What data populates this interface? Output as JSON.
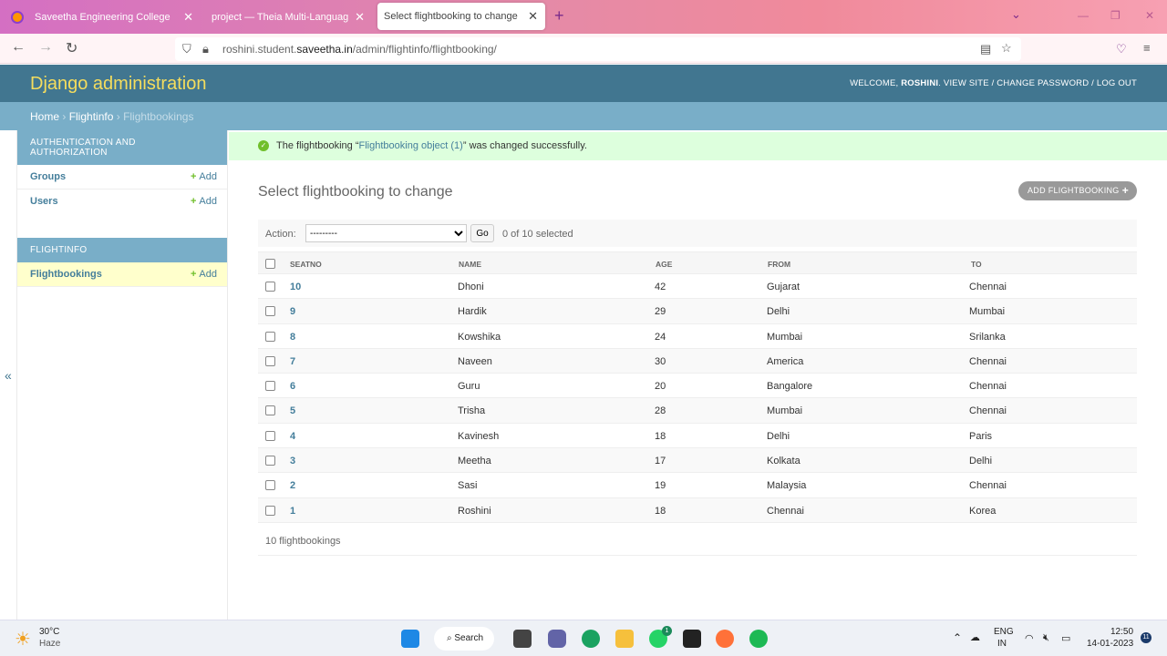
{
  "browser": {
    "tabs": [
      {
        "title": "Saveetha Engineering College"
      },
      {
        "title": "project — Theia Multi-Language Ex"
      },
      {
        "title": "Select flightbooking to change | Dj"
      }
    ],
    "url_prefix": "roshini.student.",
    "url_domain": "saveetha.in",
    "url_path": "/admin/flightinfo/flightbooking/"
  },
  "header": {
    "brand": "Django administration",
    "welcome": "WELCOME,",
    "user": "ROSHINI",
    "view_site": "VIEW SITE",
    "change_password": "CHANGE PASSWORD",
    "logout": "LOG OUT"
  },
  "breadcrumbs": {
    "home": "Home",
    "app": "Flightinfo",
    "current": "Flightbookings"
  },
  "sidebar": {
    "auth_title": "Authentication and Authorization",
    "groups": "Groups",
    "users": "Users",
    "add": "Add",
    "app_title": "Flightinfo",
    "flightbookings": "Flightbookings"
  },
  "message": {
    "pre": "The flightbooking “",
    "link": "Flightbooking object (1)",
    "post": "” was changed successfully."
  },
  "page": {
    "title": "Select flightbooking to change",
    "add_button": "ADD FLIGHTBOOKING",
    "action_label": "Action:",
    "action_default": "---------",
    "go": "Go",
    "selected": "0 of 10 selected",
    "count": "10 flightbookings"
  },
  "table": {
    "headers": [
      "SEATNO",
      "NAME",
      "AGE",
      "FROM",
      "TO"
    ],
    "rows": [
      [
        "10",
        "Dhoni",
        "42",
        "Gujarat",
        "Chennai"
      ],
      [
        "9",
        "Hardik",
        "29",
        "Delhi",
        "Mumbai"
      ],
      [
        "8",
        "Kowshika",
        "24",
        "Mumbai",
        "Srilanka"
      ],
      [
        "7",
        "Naveen",
        "30",
        "America",
        "Chennai"
      ],
      [
        "6",
        "Guru",
        "20",
        "Bangalore",
        "Chennai"
      ],
      [
        "5",
        "Trisha",
        "28",
        "Mumbai",
        "Chennai"
      ],
      [
        "4",
        "Kavinesh",
        "18",
        "Delhi",
        "Paris"
      ],
      [
        "3",
        "Meetha",
        "17",
        "Kolkata",
        "Delhi"
      ],
      [
        "2",
        "Sasi",
        "19",
        "Malaysia",
        "Chennai"
      ],
      [
        "1",
        "Roshini",
        "18",
        "Chennai",
        "Korea"
      ]
    ]
  },
  "taskbar": {
    "temp": "30°C",
    "weather": "Haze",
    "search": "Search",
    "lang1": "ENG",
    "lang2": "IN",
    "time": "12:50",
    "date": "14-01-2023",
    "notif": "11",
    "whatsapp_badge": "1"
  },
  "colors": {
    "header": "#417690",
    "breadcrumb": "#79aec8",
    "brand": "#f5dd5d",
    "link": "#447e9b",
    "success": "#dfd"
  }
}
